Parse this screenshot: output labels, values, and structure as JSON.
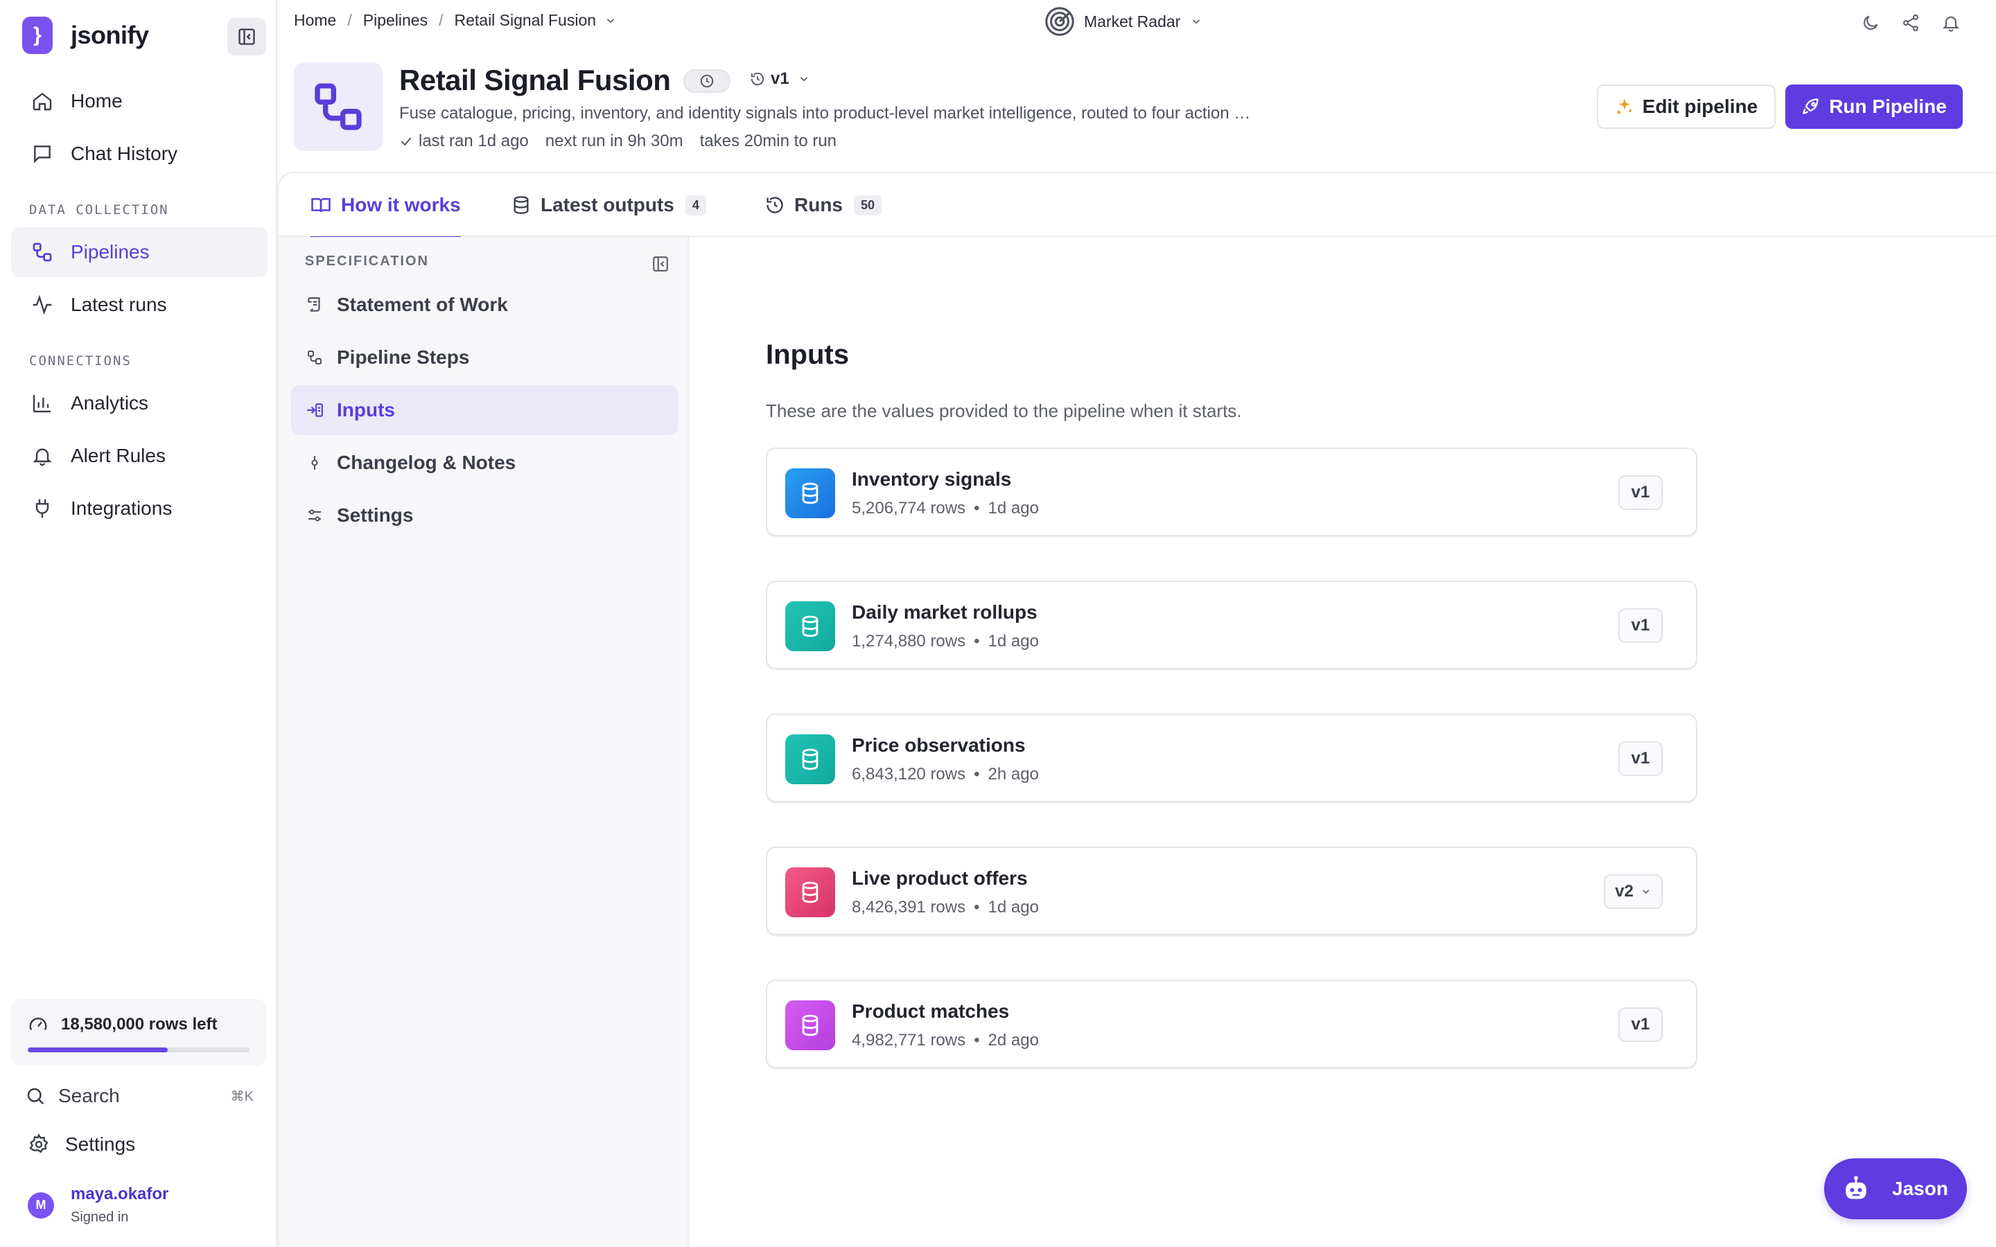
{
  "app": {
    "name": "jsonify"
  },
  "sidebar": {
    "items": [
      {
        "label": "Home",
        "icon": "home-icon"
      },
      {
        "label": "Chat History",
        "icon": "chat-icon"
      }
    ],
    "section_data_collection": "DATA COLLECTION",
    "data_items": [
      {
        "label": "Pipelines",
        "icon": "pipeline-icon",
        "active": true
      },
      {
        "label": "Latest runs",
        "icon": "activity-icon"
      }
    ],
    "section_connections": "CONNECTIONS",
    "connection_items": [
      {
        "label": "Analytics",
        "icon": "bar-chart-icon"
      },
      {
        "label": "Alert Rules",
        "icon": "bell-icon"
      },
      {
        "label": "Integrations",
        "icon": "plug-icon"
      }
    ],
    "usage": {
      "label": "18,580,000 rows left",
      "fraction": 0.63
    },
    "search": {
      "label": "Search",
      "shortcut": "⌘K"
    },
    "settings_label": "Settings",
    "user": {
      "initial": "M",
      "name": "maya.okafor",
      "status": "Signed in"
    }
  },
  "topbar": {
    "breadcrumb": [
      "Home",
      "Pipelines",
      "Retail Signal Fusion"
    ],
    "workspace": "Market Radar"
  },
  "header": {
    "title": "Retail Signal Fusion",
    "version": "v1",
    "description": "Fuse catalogue, pricing, inventory, and identity signals into product-level market intelligence, routed to four action …",
    "last_ran": "last ran 1d ago",
    "next_run": "next run in 9h 30m",
    "duration": "takes 20min to run",
    "edit_label": "Edit pipeline",
    "run_label": "Run Pipeline"
  },
  "tabs": [
    {
      "label": "How it works",
      "count": "",
      "active": true
    },
    {
      "label": "Latest outputs",
      "count": "4"
    },
    {
      "label": "Runs",
      "count": "50"
    }
  ],
  "spec": {
    "label": "SPECIFICATION",
    "items": [
      {
        "label": "Statement of Work"
      },
      {
        "label": "Pipeline Steps"
      },
      {
        "label": "Inputs",
        "active": true
      },
      {
        "label": "Changelog & Notes"
      },
      {
        "label": "Settings"
      }
    ]
  },
  "main": {
    "title": "Inputs",
    "subtitle": "These are the values provided to the pipeline when it starts.",
    "inputs": [
      {
        "name": "Inventory signals",
        "rows": "5,206,774 rows",
        "age": "1d ago",
        "version": "v1",
        "color": "#1f8ee8"
      },
      {
        "name": "Daily market rollups",
        "rows": "1,274,880 rows",
        "age": "1d ago",
        "version": "v1",
        "color": "#17b3a8"
      },
      {
        "name": "Price observations",
        "rows": "6,843,120 rows",
        "age": "2h ago",
        "version": "v1",
        "color": "#17b3a8"
      },
      {
        "name": "Live product offers",
        "rows": "8,426,391 rows",
        "age": "1d ago",
        "version": "v2",
        "color": "#e8467a"
      },
      {
        "name": "Product matches",
        "rows": "4,982,771 rows",
        "age": "2d ago",
        "version": "v1",
        "color": "#c84ee6"
      }
    ]
  },
  "chat": {
    "label": "Jason"
  },
  "colors": {
    "accent": "#5e3ce0",
    "accent_text": "#5b3dd8"
  }
}
